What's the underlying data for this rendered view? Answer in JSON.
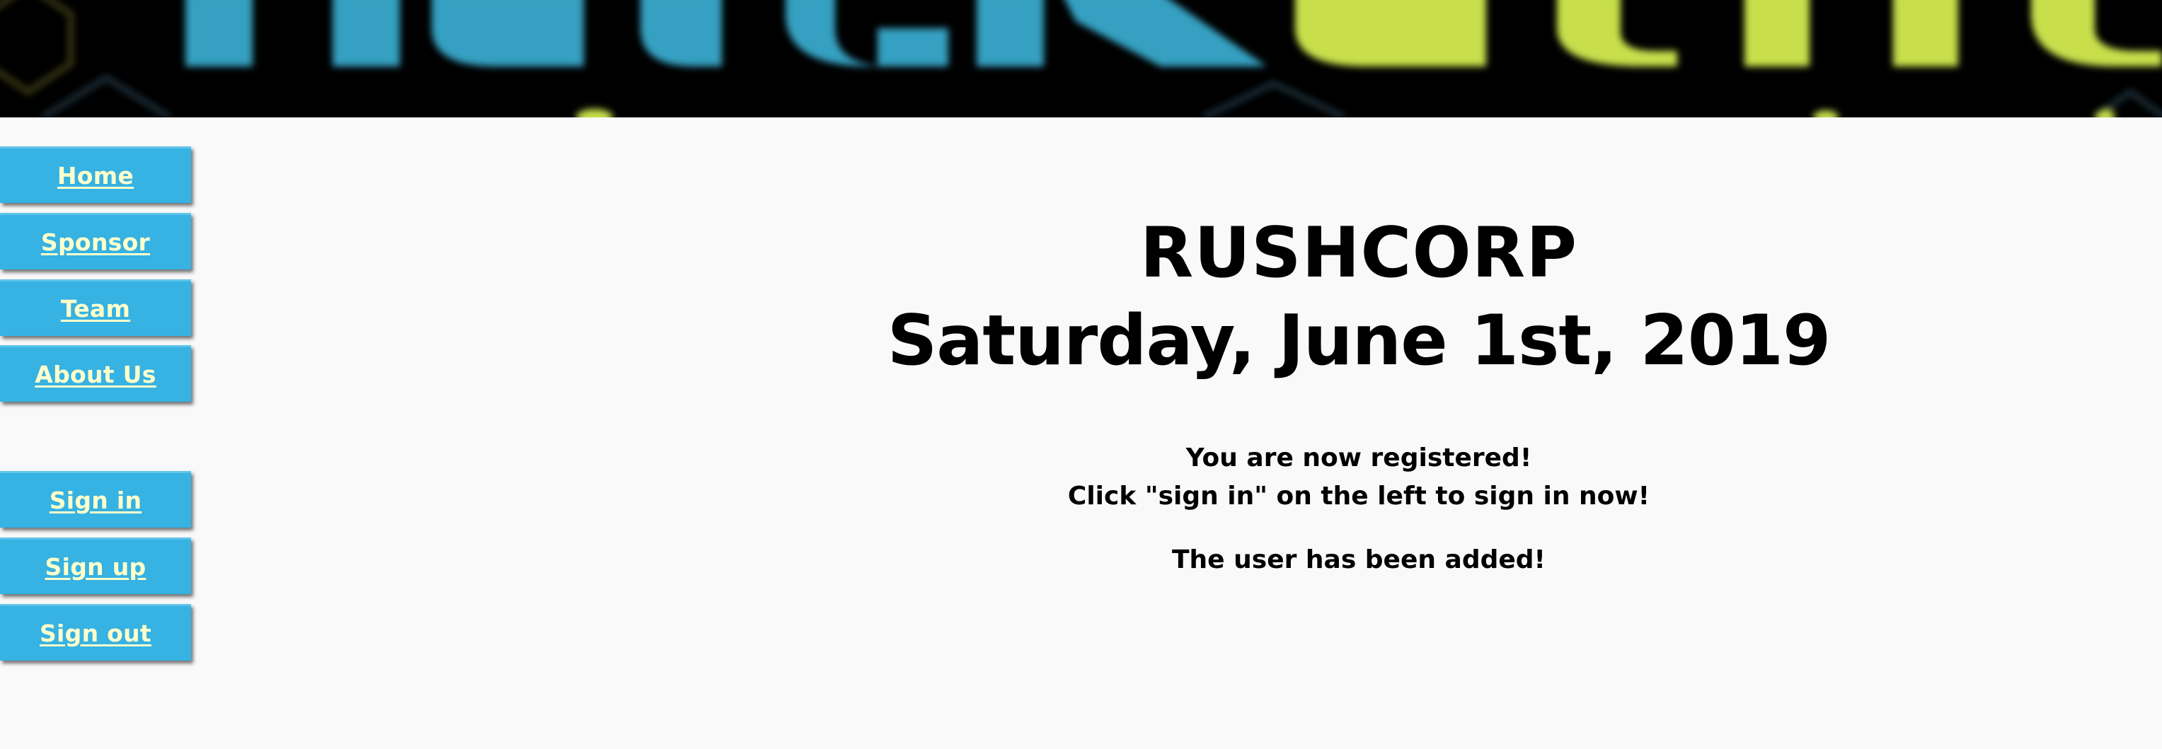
{
  "colors": {
    "banner_bg": "#000000",
    "logo_blue": "#36a0c1",
    "logo_green": "#c8df4b",
    "nav_bg": "#36b2e3",
    "nav_text": "#ffffcc",
    "page_bg": "#f9f9fa",
    "text": "#000000"
  },
  "header": {
    "banner_icon": "hackathon-logo-banner"
  },
  "sidebar": {
    "items": [
      {
        "label": "Home"
      },
      {
        "label": "Sponsor"
      },
      {
        "label": "Team"
      },
      {
        "label": "About Us"
      },
      {
        "label": "Sign in"
      },
      {
        "label": "Sign up"
      },
      {
        "label": "Sign out"
      }
    ]
  },
  "main": {
    "event_name": "RUSHCORP",
    "event_date": "Saturday, June 1st, 2019",
    "messages": {
      "registered": "You are now registered!",
      "signin_hint": "Click \"sign in\" on the left to sign in now!",
      "user_added": "The user has been added!"
    }
  }
}
